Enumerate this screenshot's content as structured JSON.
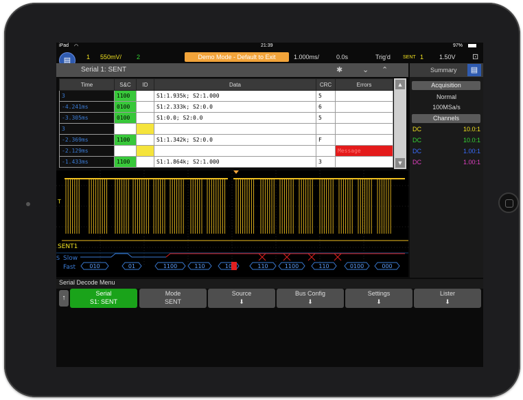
{
  "status_bar": {
    "device": "iPad",
    "time": "21:39",
    "battery": "97%"
  },
  "top_bar": {
    "ch1_num": "1",
    "ch1_scale": "550mV/",
    "ch2_num": "2",
    "demo_mode": "Demo Mode - Default to Exit",
    "timebase": "1.000ms/",
    "delay": "0.0s",
    "trig_state": "Trig'd",
    "trig_source_label": "SENT",
    "trig_ch": "1",
    "trig_level": "1.50V"
  },
  "panel": {
    "title": "Serial 1: SENT"
  },
  "lister": {
    "columns": [
      "Time",
      "S&C",
      "ID",
      "Data",
      "CRC",
      "Errors"
    ],
    "rows": [
      {
        "time": "3",
        "sc": "1100",
        "id": "",
        "data": "S1:1.935k; S2:1.000",
        "crc": "5",
        "errors": ""
      },
      {
        "time": "-4.241ms",
        "sc": "0100",
        "id": "",
        "data": "S1:2.333k; S2:0.0",
        "crc": "6",
        "errors": ""
      },
      {
        "time": "-3.305ms",
        "sc": "0100",
        "id": "",
        "data": "S1:0.0; S2:0.0",
        "crc": "5",
        "errors": ""
      },
      {
        "time": "3",
        "sc": "",
        "id": "",
        "data": "",
        "crc": "",
        "errors": ""
      },
      {
        "time": "-2.369ms",
        "sc": "1100",
        "id": "",
        "data": "S1:1.342k; S2:0.0",
        "crc": "F",
        "errors": ""
      },
      {
        "time": "-2.129ms",
        "sc": "",
        "id": "",
        "data": "",
        "crc": "",
        "errors": "Message"
      },
      {
        "time": "-1.433ms",
        "sc": "1100",
        "id": "",
        "data": "S1:1.864k; S2:1.000",
        "crc": "3",
        "errors": ""
      }
    ]
  },
  "sidebar": {
    "summary_label": "Summary",
    "acquisition_label": "Acquisition",
    "acq_mode": "Normal",
    "sample_rate": "100MSa/s",
    "channels_label": "Channels",
    "channels": [
      {
        "coupling": "DC",
        "ratio": "10.0:1",
        "color": "#f0e020"
      },
      {
        "coupling": "DC",
        "ratio": "10.0:1",
        "color": "#35d335"
      },
      {
        "coupling": "DC",
        "ratio": "1.00:1",
        "color": "#3a6cff"
      },
      {
        "coupling": "DC",
        "ratio": "1.00:1",
        "color": "#e040c0"
      }
    ]
  },
  "waveform": {
    "bus_label": "SENT1",
    "trigger_marker": "T",
    "slow_label": "Slow",
    "fast_label": "Fast",
    "s_label": "S",
    "fast_segments": [
      "010",
      "01",
      "1100",
      "110",
      "10",
      "110",
      "1100",
      "110",
      "0100",
      "000"
    ],
    "trace_color": "#f0c020"
  },
  "menu": {
    "title": "Serial Decode Menu",
    "softkeys": [
      {
        "label": "Serial",
        "value": "S1: SENT"
      },
      {
        "label": "Mode",
        "value": "SENT"
      },
      {
        "label": "Source",
        "value": ""
      },
      {
        "label": "Bus Config",
        "value": ""
      },
      {
        "label": "Settings",
        "value": ""
      },
      {
        "label": "Lister",
        "value": ""
      }
    ]
  }
}
